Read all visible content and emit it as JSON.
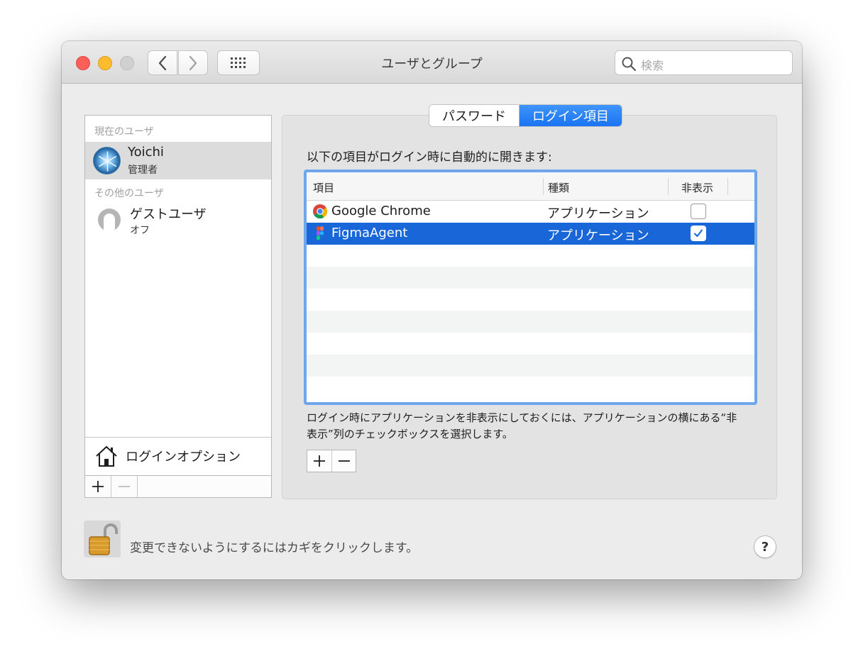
{
  "window": {
    "title": "ユーザとグループ",
    "search_placeholder": "検索"
  },
  "users": {
    "current_header": "現在のユーザ",
    "current": [
      {
        "name": "Yoichi",
        "role": "管理者",
        "selected": true,
        "icon": "snowflake-avatar-icon"
      }
    ],
    "others_header": "その他のユーザ",
    "others": [
      {
        "name": "ゲストユーザ",
        "role": "オフ",
        "icon": "guest-user-icon"
      }
    ],
    "login_options_label": "ログインオプション",
    "add_label": "+",
    "remove_label": "−"
  },
  "tabs": [
    {
      "label": "パスワード",
      "active": false
    },
    {
      "label": "ログイン項目",
      "active": true
    }
  ],
  "login_items": {
    "intro": "以下の項目がログイン時に自動的に開きます:",
    "columns": [
      "項目",
      "種類",
      "非表示"
    ],
    "rows": [
      {
        "name": "Google Chrome",
        "kind": "アプリケーション",
        "hidden": false,
        "selected": false,
        "icon": "chrome-icon"
      },
      {
        "name": "FigmaAgent",
        "kind": "アプリケーション",
        "hidden": true,
        "selected": true,
        "icon": "figma-icon"
      }
    ],
    "help_text": "ログイン時にアプリケーションを非表示にしておくには、アプリケーションの横にある“非表示”列のチェックボックスを選択します。",
    "add_label": "+",
    "remove_label": "−"
  },
  "footer": {
    "lock_text": "変更できないようにするにはカギをクリックします。",
    "help_label": "?"
  },
  "colors": {
    "accent": "#1a73f1",
    "selection": "#1866d8",
    "focus_ring": "#6fa6ee"
  }
}
